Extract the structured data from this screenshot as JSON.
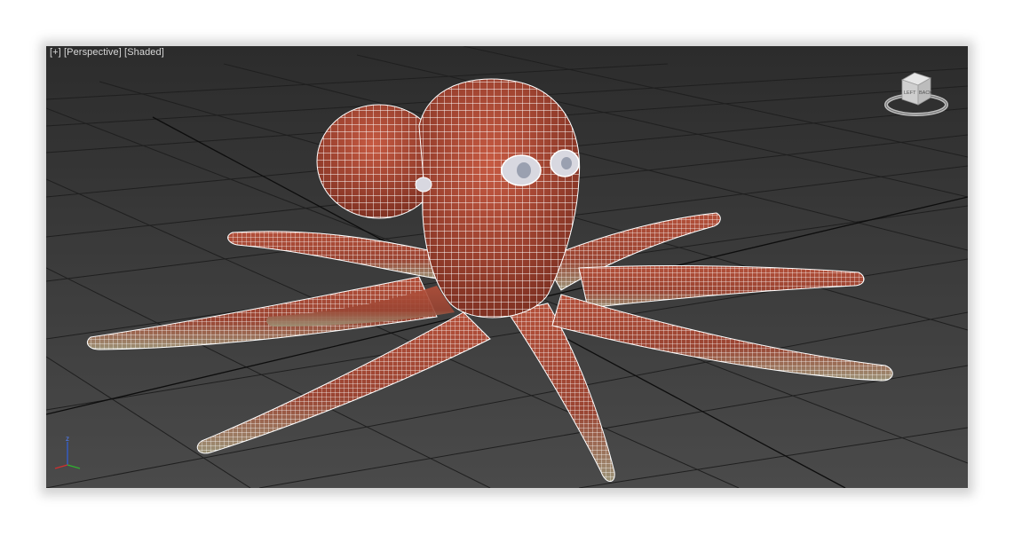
{
  "viewport": {
    "label_plus": "[+]",
    "label_view": "[Perspective]",
    "label_mode": "[Shaded]",
    "background_top": "#2c2c2c",
    "background_bottom": "#4a4a4a",
    "grid_color": "#1e1e1e",
    "grid_axis_color": "#0a0a0a"
  },
  "viewcube": {
    "icon": "viewcube-icon",
    "face_left": "LEFT",
    "face_back": "BACK"
  },
  "axis_tripod": {
    "icon": "axis-tripod-icon",
    "z_label": "z",
    "x_color": "#d03030",
    "y_color": "#30b030",
    "z_color": "#3060e0"
  },
  "model": {
    "icon": "octopus-mesh-icon",
    "body_color": "#a84a36",
    "wire_color": "#ffffff",
    "underside_color": "#8a8570",
    "eye_color": "#d8d8e0"
  }
}
